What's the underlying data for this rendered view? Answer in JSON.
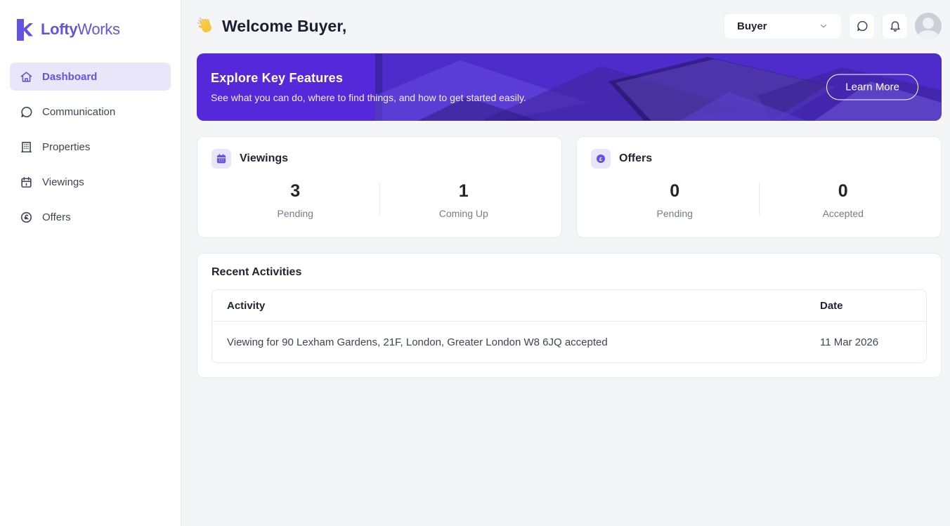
{
  "colors": {
    "accent": "#6253e1",
    "banner_purple": "#5528da",
    "active_nav_bg": "#e9e6f9",
    "page_bg": "#f4f5f7",
    "card_border": "#e9eaee",
    "muted_text": "#747c8c"
  },
  "brand": {
    "name_bold": "Lofty",
    "name_light": "Works"
  },
  "sidebar": {
    "items": [
      {
        "label": "Dashboard",
        "icon": "home",
        "active": true
      },
      {
        "label": "Communication",
        "icon": "chat-bubble",
        "active": false
      },
      {
        "label": "Properties",
        "icon": "building",
        "active": false
      },
      {
        "label": "Viewings",
        "icon": "calendar",
        "active": false
      },
      {
        "label": "Offers",
        "icon": "pound-circle",
        "active": false
      }
    ]
  },
  "header": {
    "greeting": "Welcome Buyer,",
    "role_selector": {
      "value": "Buyer"
    },
    "icons": [
      "chat-bubble",
      "bell",
      "avatar"
    ]
  },
  "banner": {
    "title": "Explore Key Features",
    "subtitle": "See what you can do, where to find things, and how to get started easily.",
    "cta_label": "Learn More"
  },
  "stat_cards": [
    {
      "title": "Viewings",
      "icon": "calendar",
      "stats": [
        {
          "value": "3",
          "label": "Pending"
        },
        {
          "value": "1",
          "label": "Coming Up"
        }
      ]
    },
    {
      "title": "Offers",
      "icon": "pound-circle",
      "stats": [
        {
          "value": "0",
          "label": "Pending"
        },
        {
          "value": "0",
          "label": "Accepted"
        }
      ]
    }
  ],
  "recent_activities": {
    "title": "Recent Activities",
    "columns": {
      "activity": "Activity",
      "date": "Date"
    },
    "rows": [
      {
        "activity": "Viewing for 90 Lexham Gardens, 21F, London, Greater London W8 6JQ accepted",
        "date": "11 Mar 2026"
      }
    ]
  }
}
